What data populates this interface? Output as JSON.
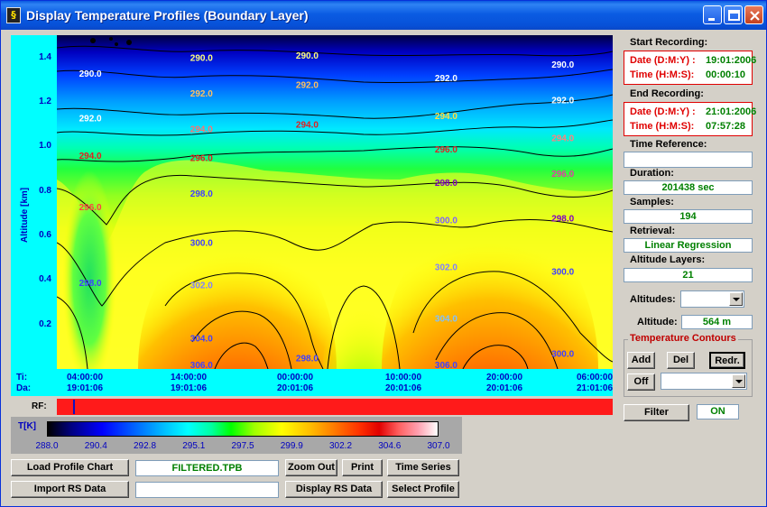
{
  "window": {
    "title": "Display Temperature Profiles (Boundary Layer)",
    "icon_char": "§"
  },
  "chart_data": {
    "type": "heatmap",
    "ylabel": "Altitude [km]",
    "ylim": [
      0.0,
      1.5
    ],
    "yticks": [
      "1.4",
      "1.2",
      "1.0",
      "0.8",
      "0.6",
      "0.4",
      "0.2"
    ],
    "xrow_labels": {
      "time": "Ti:",
      "date": "Da:"
    },
    "xticks": [
      {
        "time": "04:00:00",
        "date": "19:01:06"
      },
      {
        "time": "14:00:00",
        "date": "19:01:06"
      },
      {
        "time": "00:00:00",
        "date": "20:01:06"
      },
      {
        "time": "10:00:00",
        "date": "20:01:06"
      },
      {
        "time": "20:00:00",
        "date": "20:01:06"
      },
      {
        "time": "06:00:00",
        "date": "21:01:06"
      }
    ],
    "contour_labels": [
      {
        "text": "290.0",
        "x": 0.04,
        "y": 1.33,
        "color": "#ffffff"
      },
      {
        "text": "290.0",
        "x": 0.24,
        "y": 1.4,
        "color": "#ffff80"
      },
      {
        "text": "290.0",
        "x": 0.43,
        "y": 1.41,
        "color": "#ffff80"
      },
      {
        "text": "290.0",
        "x": 0.89,
        "y": 1.37,
        "color": "#ffffff"
      },
      {
        "text": "292.0",
        "x": 0.24,
        "y": 1.24,
        "color": "#ffc060"
      },
      {
        "text": "292.0",
        "x": 0.43,
        "y": 1.28,
        "color": "#ffc060"
      },
      {
        "text": "292.0",
        "x": 0.68,
        "y": 1.31,
        "color": "#ffffff"
      },
      {
        "text": "292.0",
        "x": 0.89,
        "y": 1.21,
        "color": "#ffffff"
      },
      {
        "text": "292.0",
        "x": 0.04,
        "y": 1.13,
        "color": "#ffffff"
      },
      {
        "text": "294.0",
        "x": 0.24,
        "y": 1.08,
        "color": "#ff7070"
      },
      {
        "text": "294.0",
        "x": 0.43,
        "y": 1.1,
        "color": "#e02020"
      },
      {
        "text": "294.0",
        "x": 0.68,
        "y": 1.14,
        "color": "#ffe040"
      },
      {
        "text": "294.0",
        "x": 0.89,
        "y": 1.04,
        "color": "#ff8080"
      },
      {
        "text": "294.0",
        "x": 0.04,
        "y": 0.96,
        "color": "#e02020"
      },
      {
        "text": "296.0",
        "x": 0.24,
        "y": 0.95,
        "color": "#e02020"
      },
      {
        "text": "296.0",
        "x": 0.68,
        "y": 0.99,
        "color": "#e02020"
      },
      {
        "text": "296.0",
        "x": 0.89,
        "y": 0.88,
        "color": "#e040a0"
      },
      {
        "text": "296.0",
        "x": 0.04,
        "y": 0.73,
        "color": "#ff4040"
      },
      {
        "text": "298.0",
        "x": 0.24,
        "y": 0.79,
        "color": "#4040ff"
      },
      {
        "text": "298.0",
        "x": 0.68,
        "y": 0.84,
        "color": "#8000c0"
      },
      {
        "text": "298.0",
        "x": 0.89,
        "y": 0.68,
        "color": "#8000c0"
      },
      {
        "text": "298.0",
        "x": 0.04,
        "y": 0.39,
        "color": "#4040ff"
      },
      {
        "text": "300.0",
        "x": 0.24,
        "y": 0.57,
        "color": "#4040ff"
      },
      {
        "text": "300.0",
        "x": 0.68,
        "y": 0.67,
        "color": "#8060ff"
      },
      {
        "text": "300.0",
        "x": 0.89,
        "y": 0.44,
        "color": "#4040ff"
      },
      {
        "text": "302.0",
        "x": 0.24,
        "y": 0.38,
        "color": "#8080ff"
      },
      {
        "text": "302.0",
        "x": 0.68,
        "y": 0.46,
        "color": "#8080ff"
      },
      {
        "text": "304.0",
        "x": 0.24,
        "y": 0.14,
        "color": "#4040ff"
      },
      {
        "text": "304.0",
        "x": 0.68,
        "y": 0.23,
        "color": "#80c0ff"
      },
      {
        "text": "298.0",
        "x": 0.43,
        "y": 0.05,
        "color": "#4040ff"
      },
      {
        "text": "306.0",
        "x": 0.24,
        "y": 0.02,
        "color": "#4040ff"
      },
      {
        "text": "306.0",
        "x": 0.68,
        "y": 0.02,
        "color": "#4040ff"
      },
      {
        "text": "300.0",
        "x": 0.89,
        "y": 0.07,
        "color": "#4040ff"
      }
    ]
  },
  "rf": {
    "label": "RF:",
    "marker": 0.03
  },
  "legend": {
    "label": "T[K]",
    "ticks": [
      "288.0",
      "290.4",
      "292.8",
      "295.1",
      "297.5",
      "299.9",
      "302.2",
      "304.6",
      "307.0"
    ]
  },
  "buttons": {
    "load_profile_chart": "Load Profile Chart",
    "import_rs_data": "Import RS Data",
    "zoom_out": "Zoom Out",
    "print": "Print",
    "time_series": "Time Series",
    "display_rs_data": "Display RS Data",
    "select_profile": "Select Profile",
    "add": "Add",
    "del": "Del",
    "redr": "Redr.",
    "off": "Off",
    "filter": "Filter"
  },
  "fields": {
    "filename": "FILTERED.TPB",
    "rs_file": ""
  },
  "right": {
    "start_title": "Start Recording:",
    "start_date_label": "Date (D:M:Y) :",
    "start_date": "19:01:2006",
    "start_time_label": "Time (H:M:S):",
    "start_time": "00:00:10",
    "end_title": "End Recording:",
    "end_date_label": "Date (D:M:Y) :",
    "end_date": "21:01:2006",
    "end_time_label": "Time (H:M:S):",
    "end_time": "07:57:28",
    "time_ref_title": "Time Reference:",
    "time_ref": "",
    "duration_title": "Duration:",
    "duration": "201438 sec",
    "samples_title": "Samples:",
    "samples": "194",
    "retrieval_title": "Retrieval:",
    "retrieval": "Linear Regression",
    "alt_layers_title": "Altitude Layers:",
    "alt_layers": "21",
    "altitudes_label": "Altitudes:",
    "altitude_label": "Altitude:",
    "altitude": "564 m",
    "contours_title": "Temperature Contours",
    "filter_state": "ON"
  }
}
